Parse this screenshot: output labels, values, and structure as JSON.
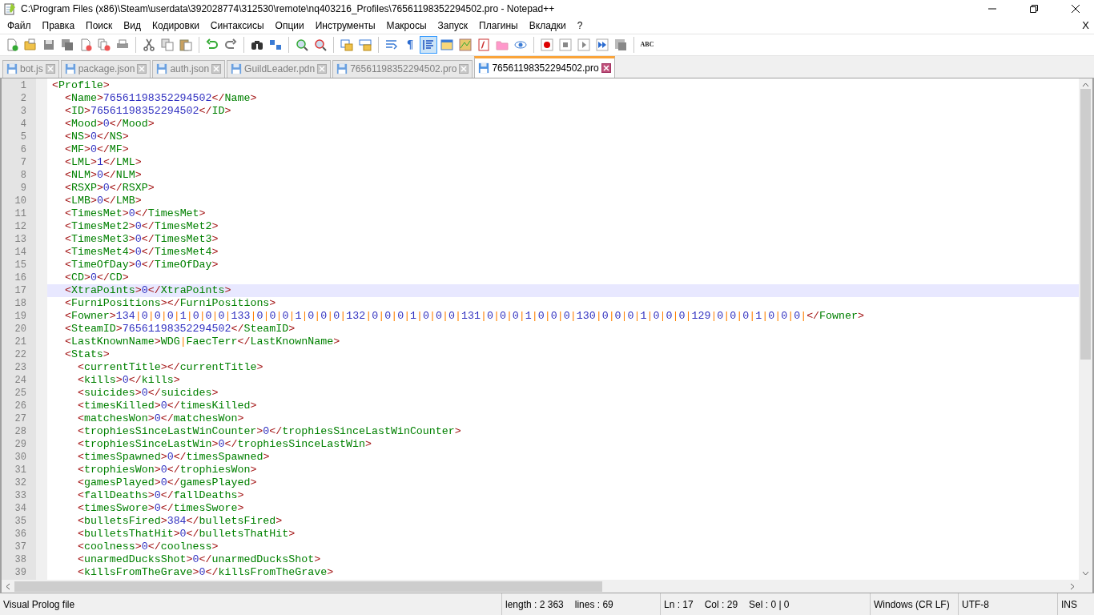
{
  "window": {
    "title": "C:\\Program Files (x86)\\Steam\\userdata\\392028774\\312530\\remote\\nq403216_Profiles\\76561198352294502.pro - Notepad++"
  },
  "menu": [
    "Файл",
    "Правка",
    "Поиск",
    "Вид",
    "Кодировки",
    "Синтаксисы",
    "Опции",
    "Инструменты",
    "Макросы",
    "Запуск",
    "Плагины",
    "Вкладки",
    "?"
  ],
  "menu_close": "X",
  "toolbar": [
    {
      "kind": "button",
      "pressed": false
    },
    {
      "kind": "button",
      "pressed": false
    },
    {
      "kind": "button",
      "pressed": false
    },
    {
      "kind": "button",
      "pressed": false
    },
    {
      "kind": "button",
      "pressed": false
    },
    {
      "kind": "button",
      "pressed": false
    },
    {
      "kind": "button",
      "pressed": false
    },
    {
      "kind": "separator"
    },
    {
      "kind": "button",
      "pressed": false
    },
    {
      "kind": "button",
      "pressed": false
    },
    {
      "kind": "button",
      "pressed": false
    },
    {
      "kind": "separator"
    },
    {
      "kind": "button",
      "pressed": false
    },
    {
      "kind": "button",
      "pressed": false
    },
    {
      "kind": "separator"
    },
    {
      "kind": "button",
      "pressed": false
    },
    {
      "kind": "button",
      "pressed": false
    },
    {
      "kind": "separator"
    },
    {
      "kind": "button",
      "pressed": false
    },
    {
      "kind": "button",
      "pressed": false
    },
    {
      "kind": "separator"
    },
    {
      "kind": "button",
      "pressed": false
    },
    {
      "kind": "button",
      "pressed": false
    },
    {
      "kind": "separator"
    },
    {
      "kind": "button",
      "pressed": false
    },
    {
      "kind": "glyph",
      "label": "¶",
      "pressed": false
    },
    {
      "kind": "button",
      "pressed": true
    },
    {
      "kind": "button",
      "pressed": false
    },
    {
      "kind": "button",
      "pressed": false
    },
    {
      "kind": "button",
      "pressed": false
    },
    {
      "kind": "button",
      "pressed": false
    },
    {
      "kind": "button",
      "pressed": false
    },
    {
      "kind": "separator"
    },
    {
      "kind": "button",
      "pressed": false
    },
    {
      "kind": "button",
      "pressed": false
    },
    {
      "kind": "button",
      "pressed": false
    },
    {
      "kind": "button",
      "pressed": false
    },
    {
      "kind": "button",
      "pressed": false
    },
    {
      "kind": "separator"
    },
    {
      "kind": "glyph",
      "label": "ABC"
    }
  ],
  "tabs": [
    {
      "label": "bot.js",
      "selected": false
    },
    {
      "label": "package.json",
      "selected": false
    },
    {
      "label": "auth.json",
      "selected": false
    },
    {
      "label": "GuildLeader.pdn",
      "selected": false
    },
    {
      "label": "76561198352294502.pro",
      "selected": false
    },
    {
      "label": "76561198352294502.pro",
      "selected": true
    }
  ],
  "editor": {
    "lines": [
      {
        "number": "1",
        "text": "<Profile>",
        "current": false
      },
      {
        "number": "2",
        "text": "  <Name>76561198352294502</Name>",
        "current": false
      },
      {
        "number": "3",
        "text": "  <ID>76561198352294502</ID>",
        "current": false
      },
      {
        "number": "4",
        "text": "  <Mood>0</Mood>",
        "current": false
      },
      {
        "number": "5",
        "text": "  <NS>0</NS>",
        "current": false
      },
      {
        "number": "6",
        "text": "  <MF>0</MF>",
        "current": false
      },
      {
        "number": "7",
        "text": "  <LML>1</LML>",
        "current": false
      },
      {
        "number": "8",
        "text": "  <NLM>0</NLM>",
        "current": false
      },
      {
        "number": "9",
        "text": "  <RSXP>0</RSXP>",
        "current": false
      },
      {
        "number": "10",
        "text": "  <LMB>0</LMB>",
        "current": false
      },
      {
        "number": "11",
        "text": "  <TimesMet>0</TimesMet>",
        "current": false
      },
      {
        "number": "12",
        "text": "  <TimesMet2>0</TimesMet2>",
        "current": false
      },
      {
        "number": "13",
        "text": "  <TimesMet3>0</TimesMet3>",
        "current": false
      },
      {
        "number": "14",
        "text": "  <TimesMet4>0</TimesMet4>",
        "current": false
      },
      {
        "number": "15",
        "text": "  <TimeOfDay>0</TimeOfDay>",
        "current": false
      },
      {
        "number": "16",
        "text": "  <CD>0</CD>",
        "current": false
      },
      {
        "number": "17",
        "text": "  <XtraPoints>0</XtraPoints>",
        "current": true
      },
      {
        "number": "18",
        "text": "  <FurniPositions></FurniPositions>",
        "current": false
      },
      {
        "number": "19",
        "text": "  <Fowner>134|0|0|0|1|0|0|0|133|0|0|0|1|0|0|0|132|0|0|0|1|0|0|0|131|0|0|0|1|0|0|0|130|0|0|0|1|0|0|0|129|0|0|0|1|0|0|0|</Fowner>",
        "current": false
      },
      {
        "number": "20",
        "text": "  <SteamID>76561198352294502</SteamID>",
        "current": false
      },
      {
        "number": "21",
        "text": "  <LastKnownName>WDG|FaecTerr</LastKnownName>",
        "current": false
      },
      {
        "number": "22",
        "text": "  <Stats>",
        "current": false
      },
      {
        "number": "23",
        "text": "    <currentTitle></currentTitle>",
        "current": false
      },
      {
        "number": "24",
        "text": "    <kills>0</kills>",
        "current": false
      },
      {
        "number": "25",
        "text": "    <suicides>0</suicides>",
        "current": false
      },
      {
        "number": "26",
        "text": "    <timesKilled>0</timesKilled>",
        "current": false
      },
      {
        "number": "27",
        "text": "    <matchesWon>0</matchesWon>",
        "current": false
      },
      {
        "number": "28",
        "text": "    <trophiesSinceLastWinCounter>0</trophiesSinceLastWinCounter>",
        "current": false
      },
      {
        "number": "29",
        "text": "    <trophiesSinceLastWin>0</trophiesSinceLastWin>",
        "current": false
      },
      {
        "number": "30",
        "text": "    <timesSpawned>0</timesSpawned>",
        "current": false
      },
      {
        "number": "31",
        "text": "    <trophiesWon>0</trophiesWon>",
        "current": false
      },
      {
        "number": "32",
        "text": "    <gamesPlayed>0</gamesPlayed>",
        "current": false
      },
      {
        "number": "33",
        "text": "    <fallDeaths>0</fallDeaths>",
        "current": false
      },
      {
        "number": "34",
        "text": "    <timesSwore>0</timesSwore>",
        "current": false
      },
      {
        "number": "35",
        "text": "    <bulletsFired>384</bulletsFired>",
        "current": false
      },
      {
        "number": "36",
        "text": "    <bulletsThatHit>0</bulletsThatHit>",
        "current": false
      },
      {
        "number": "37",
        "text": "    <coolness>0</coolness>",
        "current": false
      },
      {
        "number": "38",
        "text": "    <unarmedDucksShot>0</unarmedDucksShot>",
        "current": false
      },
      {
        "number": "39",
        "text": "    <killsFromTheGrave>0</killsFromTheGrave>",
        "current": false
      }
    ]
  },
  "status_bar": {
    "file_type": "Visual Prolog file",
    "length": "length : 2 363",
    "lines": "lines : 69",
    "line": "Ln : 17",
    "column": "Col : 29",
    "selection": "Sel : 0 | 0",
    "eol": "Windows (CR LF)",
    "encoding": "UTF-8",
    "mode": "INS"
  }
}
